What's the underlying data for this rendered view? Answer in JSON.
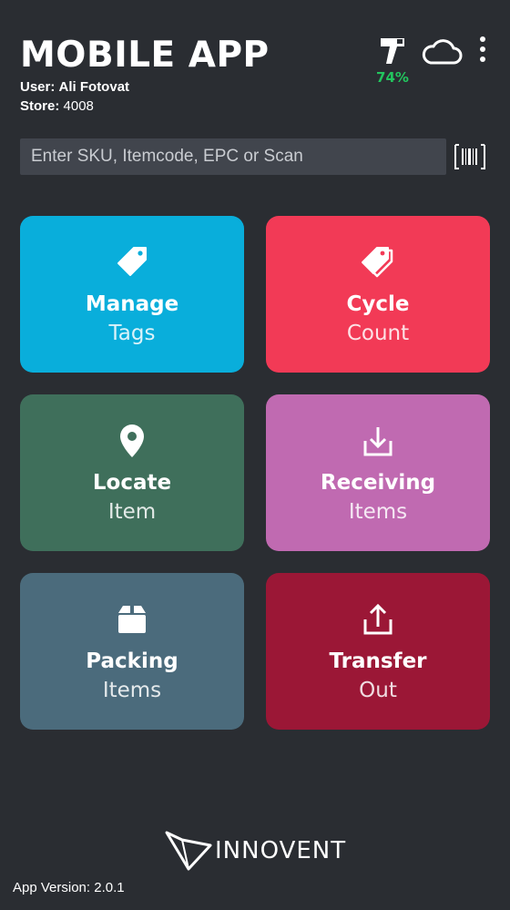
{
  "header": {
    "title": "MOBILE APP",
    "user_label": "User:",
    "user_value": "Ali Fotovat",
    "store_label": "Store:",
    "store_value": "4008",
    "battery_percent": "74%",
    "battery_color": "#22c55e"
  },
  "search": {
    "placeholder": "Enter SKU, Itemcode, EPC or Scan",
    "value": ""
  },
  "tiles": [
    {
      "title": "Manage",
      "subtitle": "Tags",
      "icon": "tag-icon",
      "color": "#09aedb"
    },
    {
      "title": "Cycle",
      "subtitle": "Count",
      "icon": "tags-icon",
      "color": "#f23a56"
    },
    {
      "title": "Locate",
      "subtitle": "Item",
      "icon": "map-pin-icon",
      "color": "#3f6f5b"
    },
    {
      "title": "Receiving",
      "subtitle": "Items",
      "icon": "download-tray-icon",
      "color": "#c06ab1"
    },
    {
      "title": "Packing",
      "subtitle": "Items",
      "icon": "box-icon",
      "color": "#4b6b7c"
    },
    {
      "title": "Transfer",
      "subtitle": "Out",
      "icon": "upload-tray-icon",
      "color": "#9b1736"
    }
  ],
  "footer": {
    "logo_text": "INNOVENT",
    "app_version": "App Version: 2.0.1"
  }
}
